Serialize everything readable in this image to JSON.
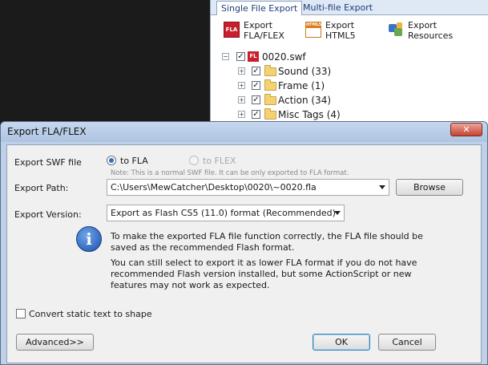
{
  "background_app": {
    "tabs": [
      {
        "label": "Single File Export"
      },
      {
        "label": "Multi-file Export"
      }
    ],
    "ribbon": {
      "fla": {
        "label": "Export\nFLA/FLEX",
        "icon": "fla-icon",
        "badge": "FLA"
      },
      "html5": {
        "label": "Export\nHTML5",
        "icon": "html5-icon",
        "badge": "HTML5"
      },
      "resources": {
        "label": "Export\nResources",
        "icon": "resources-icon"
      }
    },
    "tree": {
      "root": {
        "label": "0020.swf",
        "badge": "FL",
        "checked": true
      },
      "items": [
        {
          "label": "Sound (33)",
          "checked": true
        },
        {
          "label": "Frame (1)",
          "checked": true
        },
        {
          "label": "Action (34)",
          "checked": true
        },
        {
          "label": "Misc Tags (4)",
          "checked": true
        }
      ]
    }
  },
  "dialog": {
    "title": "Export FLA/FLEX",
    "close_glyph": "✕",
    "export_swf_label": "Export SWF file",
    "radio_fla": "to FLA",
    "radio_flex": "to FLEX",
    "selected_target": "to FLA",
    "note": "Note: This is a normal SWF file. It can be only exported to FLA format.",
    "export_path_label": "Export Path:",
    "export_path_value": "C:\\Users\\MewCatcher\\Desktop\\0020\\~0020.fla",
    "browse_label": "Browse",
    "export_version_label": "Export Version:",
    "export_version_value": "Export as Flash CS5 (11.0) format (Recommended)",
    "info_glyph": "i",
    "info_para1": "To make the exported FLA file function correctly, the FLA file should be saved as the recommended Flash format.",
    "info_para2": "You can still select to export it as lower FLA format if you do not have recommended Flash version installed, but some ActionScript or new features may not work as expected.",
    "convert_text_label": "Convert static text to shape",
    "convert_text_checked": false,
    "advanced_label": "Advanced>>",
    "ok_label": "OK",
    "cancel_label": "Cancel"
  }
}
